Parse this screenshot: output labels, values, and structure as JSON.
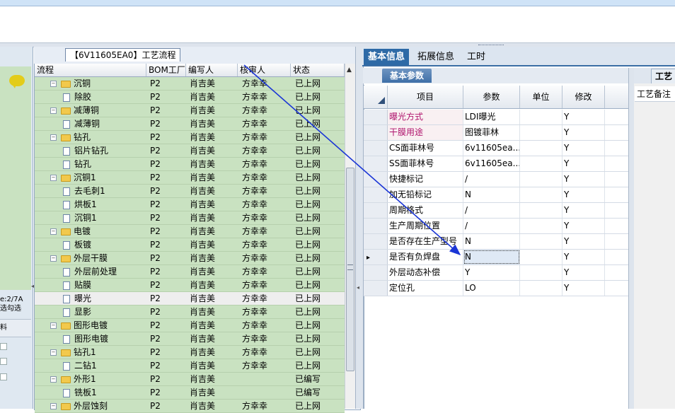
{
  "tree": {
    "title": "【6V11605EA0】工艺流程",
    "columns": [
      "流程",
      "BOM工厂",
      "编写人",
      "核审人",
      "状态"
    ],
    "rows": [
      {
        "name": "沉铜",
        "type": "folder",
        "level": 1,
        "factory": "P2",
        "writer": "肖吉美",
        "reviewer": "方幸幸",
        "status": "已上网"
      },
      {
        "name": "除胶",
        "type": "doc",
        "level": 2,
        "factory": "P2",
        "writer": "肖吉美",
        "reviewer": "方幸幸",
        "status": "已上网"
      },
      {
        "name": "减薄铜",
        "type": "folder",
        "level": 1,
        "factory": "P2",
        "writer": "肖吉美",
        "reviewer": "方幸幸",
        "status": "已上网"
      },
      {
        "name": "减薄铜",
        "type": "doc",
        "level": 2,
        "factory": "P2",
        "writer": "肖吉美",
        "reviewer": "方幸幸",
        "status": "已上网"
      },
      {
        "name": "钻孔",
        "type": "folder",
        "level": 1,
        "factory": "P2",
        "writer": "肖吉美",
        "reviewer": "方幸幸",
        "status": "已上网"
      },
      {
        "name": "铝片钻孔",
        "type": "doc",
        "level": 2,
        "factory": "P2",
        "writer": "肖吉美",
        "reviewer": "方幸幸",
        "status": "已上网"
      },
      {
        "name": "钻孔",
        "type": "doc",
        "level": 2,
        "factory": "P2",
        "writer": "肖吉美",
        "reviewer": "方幸幸",
        "status": "已上网"
      },
      {
        "name": "沉铜1",
        "type": "folder",
        "level": 1,
        "factory": "P2",
        "writer": "肖吉美",
        "reviewer": "方幸幸",
        "status": "已上网"
      },
      {
        "name": "去毛刺1",
        "type": "doc",
        "level": 2,
        "factory": "P2",
        "writer": "肖吉美",
        "reviewer": "方幸幸",
        "status": "已上网"
      },
      {
        "name": "烘板1",
        "type": "doc",
        "level": 2,
        "factory": "P2",
        "writer": "肖吉美",
        "reviewer": "方幸幸",
        "status": "已上网"
      },
      {
        "name": "沉铜1",
        "type": "doc",
        "level": 2,
        "factory": "P2",
        "writer": "肖吉美",
        "reviewer": "方幸幸",
        "status": "已上网"
      },
      {
        "name": "电镀",
        "type": "folder",
        "level": 1,
        "factory": "P2",
        "writer": "肖吉美",
        "reviewer": "方幸幸",
        "status": "已上网"
      },
      {
        "name": "板镀",
        "type": "doc",
        "level": 2,
        "factory": "P2",
        "writer": "肖吉美",
        "reviewer": "方幸幸",
        "status": "已上网"
      },
      {
        "name": "外层干膜",
        "type": "folder",
        "level": 1,
        "factory": "P2",
        "writer": "肖吉美",
        "reviewer": "方幸幸",
        "status": "已上网"
      },
      {
        "name": "外层前处理",
        "type": "doc",
        "level": 2,
        "factory": "P2",
        "writer": "肖吉美",
        "reviewer": "方幸幸",
        "status": "已上网"
      },
      {
        "name": "贴膜",
        "type": "doc",
        "level": 2,
        "factory": "P2",
        "writer": "肖吉美",
        "reviewer": "方幸幸",
        "status": "已上网"
      },
      {
        "name": "曝光",
        "type": "doc",
        "level": 2,
        "factory": "P2",
        "writer": "肖吉美",
        "reviewer": "方幸幸",
        "status": "已上网",
        "selected": true
      },
      {
        "name": "显影",
        "type": "doc",
        "level": 2,
        "factory": "P2",
        "writer": "肖吉美",
        "reviewer": "方幸幸",
        "status": "已上网"
      },
      {
        "name": "图形电镀",
        "type": "folder",
        "level": 1,
        "factory": "P2",
        "writer": "肖吉美",
        "reviewer": "方幸幸",
        "status": "已上网"
      },
      {
        "name": "图形电镀",
        "type": "doc",
        "level": 2,
        "factory": "P2",
        "writer": "肖吉美",
        "reviewer": "方幸幸",
        "status": "已上网"
      },
      {
        "name": "钻孔1",
        "type": "folder",
        "level": 1,
        "factory": "P2",
        "writer": "肖吉美",
        "reviewer": "方幸幸",
        "status": "已上网"
      },
      {
        "name": "二钻1",
        "type": "doc",
        "level": 2,
        "factory": "P2",
        "writer": "肖吉美",
        "reviewer": "方幸幸",
        "status": "已上网"
      },
      {
        "name": "外形1",
        "type": "folder",
        "level": 1,
        "factory": "P2",
        "writer": "肖吉美",
        "reviewer": "",
        "status": "已编写"
      },
      {
        "name": "铣板1",
        "type": "doc",
        "level": 2,
        "factory": "P2",
        "writer": "肖吉美",
        "reviewer": "",
        "status": "已编写"
      },
      {
        "name": "外层蚀刻",
        "type": "folder",
        "level": 1,
        "factory": "P2",
        "writer": "肖吉美",
        "reviewer": "方幸幸",
        "status": "已上网"
      }
    ]
  },
  "left": {
    "text1": "e:2/7A",
    "text2": "选勾选",
    "text3": "料"
  },
  "right": {
    "tabs": [
      "基本信息",
      "拓展信息",
      "工时"
    ],
    "subtab": "基本参数",
    "columns": [
      "项目",
      "参数",
      "单位",
      "修改"
    ],
    "rows": [
      {
        "item": "曝光方式",
        "param": "LDI曝光",
        "unit": "",
        "modify": "Y",
        "highlight": true
      },
      {
        "item": "干膜用途",
        "param": "图镀菲林",
        "unit": "",
        "modify": "Y",
        "highlight": true
      },
      {
        "item": "CS面菲林号",
        "param": "6v11605ea...",
        "unit": "",
        "modify": "Y"
      },
      {
        "item": "SS面菲林号",
        "param": "6v11605ea...",
        "unit": "",
        "modify": "Y"
      },
      {
        "item": "快捷标记",
        "param": "/",
        "unit": "",
        "modify": "Y"
      },
      {
        "item": "加无铅标记",
        "param": "N",
        "unit": "",
        "modify": "Y"
      },
      {
        "item": "周期格式",
        "param": "/",
        "unit": "",
        "modify": "Y"
      },
      {
        "item": "生产周期位置",
        "param": "/",
        "unit": "",
        "modify": "Y"
      },
      {
        "item": "是否存在生产型号",
        "param": "N",
        "unit": "",
        "modify": "Y"
      },
      {
        "item": "是否有负焊盘",
        "param": "N",
        "unit": "",
        "modify": "Y",
        "current": true
      },
      {
        "item": "外层动态补偿",
        "param": "Y",
        "unit": "",
        "modify": "Y"
      },
      {
        "item": "定位孔",
        "param": "LO",
        "unit": "",
        "modify": "Y"
      }
    ]
  },
  "far": {
    "tab": "工艺",
    "label": "工艺备注"
  },
  "colors": {
    "tree_row_bg": "#c9e2c1",
    "highlight_text": "#b0156e",
    "tab_active": "#2e6aa6",
    "annotation_arrow": "#1a35d6"
  }
}
